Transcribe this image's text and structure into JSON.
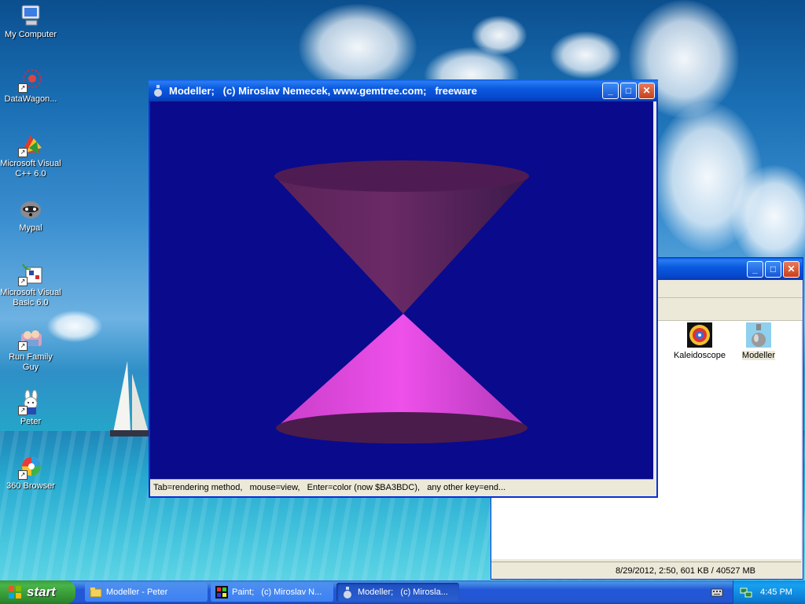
{
  "desktop": {
    "icons": [
      {
        "label": "My Computer",
        "icon": "my-computer-icon"
      },
      {
        "label": "DataWagon...",
        "icon": "datawagon-icon"
      },
      {
        "label": "Microsoft Visual C++ 6.0",
        "icon": "visual-cpp-icon"
      },
      {
        "label": "Mypal",
        "icon": "mypal-raccoon-icon"
      },
      {
        "label": "Microsoft Visual Basic 6.0",
        "icon": "visual-basic-icon"
      },
      {
        "label": "Run Family Guy",
        "icon": "family-guy-icon"
      },
      {
        "label": "Peter",
        "icon": "peter-bunny-icon"
      },
      {
        "label": "360 Browser",
        "icon": "360-browser-icon"
      }
    ]
  },
  "modeller_window": {
    "title": "Modeller;   (c) Miroslav Nemecek, www.gemtree.com;   freeware",
    "status": "Tab=rendering method,   mouse=view,   Enter=color (now $BA3BDC),   any other key=end...",
    "background_color": "#0a0a8c",
    "cone_color": "#BA3BDC"
  },
  "explorer_window": {
    "items": [
      {
        "label": "Kaleidoscope",
        "icon": "kaleidoscope-icon"
      },
      {
        "label": "Modeller",
        "icon": "modeller-vase-icon"
      }
    ],
    "status": "8/29/2012, 2:50, 601 KB / 40527 MB"
  },
  "taskbar": {
    "start_label": "start",
    "tasks": [
      {
        "label": "Modeller - Peter",
        "icon": "folder-icon"
      },
      {
        "label": "Paint;   (c) Miroslav N...",
        "icon": "paint-icon"
      },
      {
        "label": "Modeller;   (c) Mirosla...",
        "icon": "modeller-vase-icon"
      }
    ],
    "clock": "4:45 PM"
  }
}
